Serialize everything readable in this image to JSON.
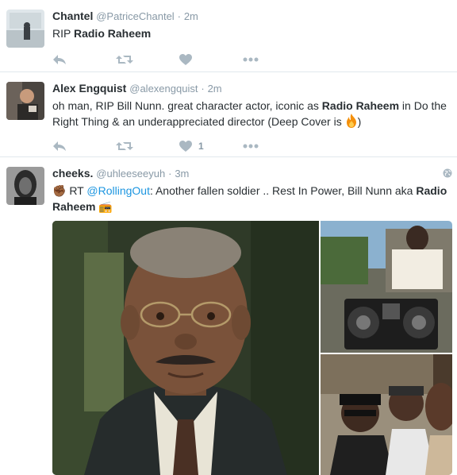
{
  "tweets": [
    {
      "name": "Chantel",
      "handle": "@PatriceChantel",
      "dot": "·",
      "time": "2m",
      "text_pre": "RIP ",
      "text_bold": "Radio Raheem",
      "like_count": ""
    },
    {
      "name": "Alex Engquist",
      "handle": "@alexengquist",
      "dot": "·",
      "time": "2m",
      "text_pre": "oh man, RIP Bill Nunn. great character actor, iconic as ",
      "text_bold": "Radio Raheem",
      "text_post": " in Do the Right Thing & an underappreciated director (Deep Cover is ",
      "text_end": ")",
      "like_count": "1"
    },
    {
      "name": "cheeks.",
      "handle": "@uhleeseeyuh",
      "dot": "·",
      "time": "3m",
      "text_fist": "✊🏾",
      "text_rt": " RT ",
      "text_mention": "@RollingOut",
      "text_mid": ": Another fallen soldier .. Rest In Power, Bill Nunn aka ",
      "text_bold": "Radio Raheem",
      "text_radio": " 📻"
    }
  ],
  "icons": {
    "reply": "reply-icon",
    "retweet": "retweet-icon",
    "like": "heart-icon",
    "more": "more-icon",
    "globe": "globe-icon"
  },
  "colors": {
    "icon": "#aab8c2",
    "link": "#1b95e0",
    "meta": "#8899a6"
  }
}
